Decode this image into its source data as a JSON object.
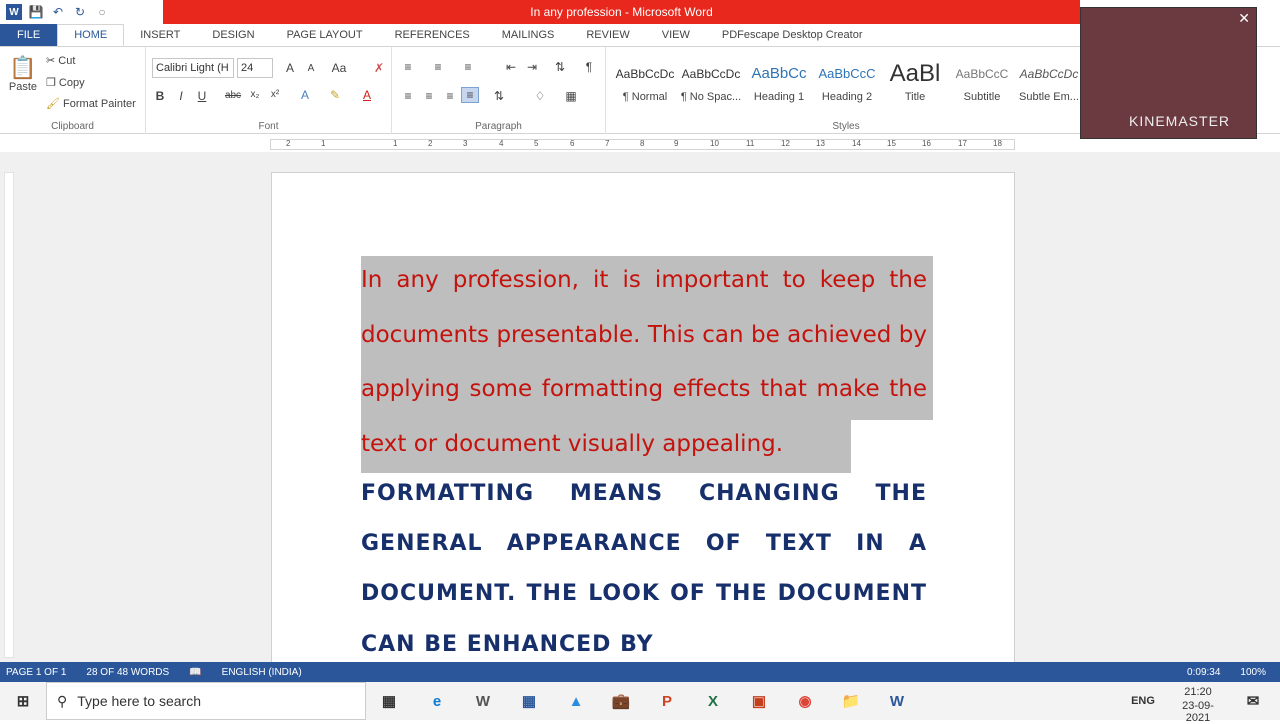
{
  "window": {
    "title": "In any profession  -  Microsoft Word"
  },
  "tabs": [
    "FILE",
    "HOME",
    "INSERT",
    "DESIGN",
    "PAGE LAYOUT",
    "REFERENCES",
    "MAILINGS",
    "REVIEW",
    "VIEW",
    "PDFescape Desktop Creator"
  ],
  "clipboard": {
    "paste": "Paste",
    "cut": "Cut",
    "copy": "Copy",
    "format_painter": "Format Painter",
    "label": "Clipboard"
  },
  "font": {
    "name": "Calibri Light (H",
    "size": "24",
    "label": "Font",
    "bold": "B",
    "italic": "I",
    "underline": "U",
    "strike": "abc",
    "sub": "x₂",
    "sup": "x²",
    "grow": "A",
    "shrink": "A",
    "case": "Aa"
  },
  "paragraph": {
    "label": "Paragraph"
  },
  "styles": {
    "label": "Styles",
    "items": [
      {
        "preview": "AaBbCcDc",
        "name": "¶ Normal"
      },
      {
        "preview": "AaBbCcDc",
        "name": "¶ No Spac..."
      },
      {
        "preview": "AaBbCc",
        "name": "Heading 1"
      },
      {
        "preview": "AaBbCcC",
        "name": "Heading 2"
      },
      {
        "preview": "AaBl",
        "name": "Title"
      },
      {
        "preview": "AaBbCcC",
        "name": "Subtitle"
      },
      {
        "preview": "AaBbCcDc",
        "name": "Subtle Em..."
      }
    ]
  },
  "ruler": {
    "ticks": [
      "2",
      "1",
      "1",
      "2",
      "3",
      "4",
      "5",
      "6",
      "7",
      "8",
      "9",
      "10",
      "11",
      "12",
      "13",
      "14",
      "15",
      "16",
      "17",
      "18"
    ]
  },
  "document": {
    "para1": "In any profession, it is important to keep the documents presentable. This can be achieved by applying some formatting effects that make the text or document visually appealing.",
    "para2": "FORMATTING MEANS CHANGING THE GENERAL APPEARANCE OF TEXT IN A DOCUMENT. THE LOOK OF THE DOCUMENT CAN BE ENHANCED BY"
  },
  "status": {
    "page": "PAGE 1 OF 1",
    "words": "28 OF 48 WORDS",
    "language": "ENGLISH (INDIA)",
    "timer": "0:09:34",
    "zoom": "100%"
  },
  "taskbar": {
    "search_placeholder": "Type here to search",
    "lang": "ENG",
    "time": "21:20",
    "date": "23-09-2021"
  },
  "overlay": {
    "brand": "KINEMASTER"
  }
}
